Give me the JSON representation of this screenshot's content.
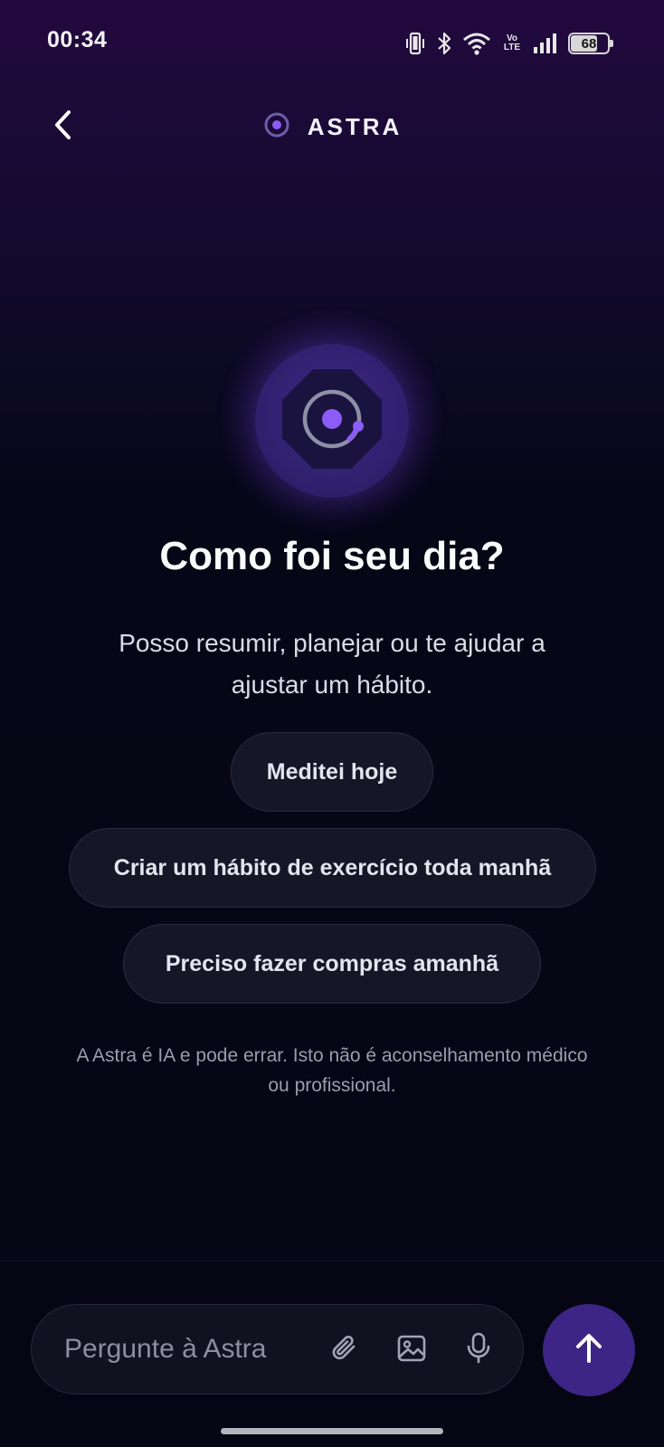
{
  "status_bar": {
    "time": "00:34",
    "network_label": "Vo\nLTE",
    "battery_level": "68",
    "icons": [
      "vibrate-icon",
      "bluetooth-icon",
      "wifi-icon",
      "volte-icon",
      "signal-icon",
      "battery-icon"
    ]
  },
  "header": {
    "title": "ASTRA",
    "back_icon": "chevron-left-icon",
    "logo_icon": "astra-orbit-icon"
  },
  "hero": {
    "greeting": "Como foi seu dia?",
    "subtitle": "Posso resumir, planejar ou te ajudar a ajustar um hábito."
  },
  "suggestions": [
    {
      "label": "Meditei hoje"
    },
    {
      "label": "Criar um hábito de exercício toda manhã"
    },
    {
      "label": "Preciso fazer compras amanhã"
    }
  ],
  "disclaimer": "A Astra é IA e pode errar. Isto não é aconselhamento médico ou profissional.",
  "composer": {
    "placeholder": "Pergunte à Astra",
    "value": "",
    "icons": [
      "paperclip-icon",
      "image-icon",
      "microphone-icon",
      "arrow-up-icon"
    ]
  },
  "colors": {
    "accent": "#8b5cf6",
    "send_button": "#3d2585",
    "background_top": "#23093f",
    "background_bottom": "#050513"
  }
}
